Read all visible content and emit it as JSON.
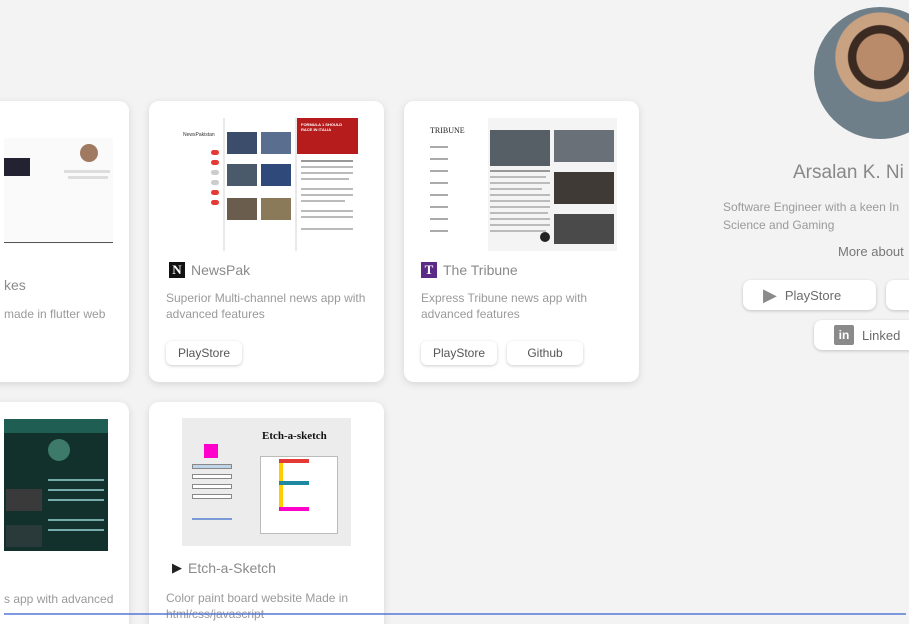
{
  "projects": [
    {
      "id": "flutter-web",
      "title": "kes",
      "desc": "made in flutter web"
    },
    {
      "id": "newspak",
      "title": "NewsPak",
      "logo_letter": "N",
      "logo_color": "#111111",
      "desc_line1": "Superior Multi-channel news app with",
      "desc_line2": "advanced features",
      "buttons": [
        "PlayStore"
      ],
      "shot_labels": {
        "app_name": "NewsPakistan",
        "headline": "FORMULA 1 SHOULD RACE IN ITALIA"
      }
    },
    {
      "id": "tribune",
      "title": "The Tribune",
      "logo_letter": "T",
      "logo_color": "#5b2a86",
      "desc_line1": "Express Tribune news app with",
      "desc_line2": "advanced features",
      "buttons": [
        "PlayStore",
        "Github"
      ],
      "shot_labels": {
        "masthead": "TRIBUNE"
      }
    },
    {
      "id": "news-dark",
      "desc": "s app with advanced"
    },
    {
      "id": "etch",
      "title": "Etch-a-Sketch",
      "desc_line1": "Color paint board website Made in",
      "desc_line2": "html/css/javascript",
      "shot_labels": {
        "heading": "Etch-a-sketch"
      }
    }
  ],
  "profile": {
    "name": "Arsalan K. Ni",
    "bio_line1": "Software Engineer with a keen In",
    "bio_line2": "Science and Gaming",
    "more": "More about",
    "playstore": "PlayStore",
    "linkedin": "Linked"
  },
  "colors": {
    "accent": "#4a6fd1",
    "background": "#f3f3f3"
  }
}
